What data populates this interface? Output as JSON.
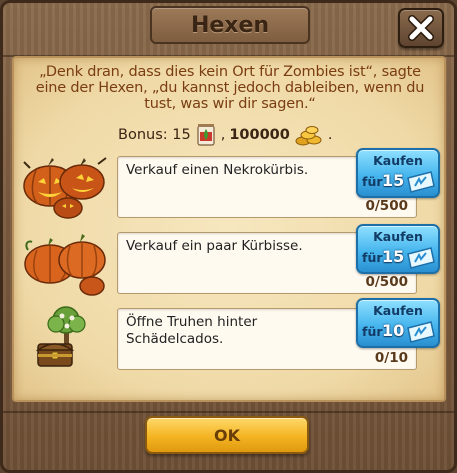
{
  "dialog": {
    "title": "Hexen",
    "quote_line1": "„Denk dran, dass dies kein Ort für Zombies ist“, sagte",
    "quote_line2": "eine der Hexen, „du kannst jedoch dableiben, wenn du",
    "quote_line3": "tust, was wir dir sagen.“",
    "bonus_label": "Bonus: 15",
    "bonus_separator": ",",
    "bonus_coins": "100000",
    "bonus_end": ".",
    "ok_label": "OK"
  },
  "tasks": [
    {
      "description": "Verkauf einen Nekrokürbis.",
      "progress": "0/500",
      "buy_label": "Kaufen",
      "buy_for": "für",
      "buy_price": "15",
      "icon": "jack-o-lantern-pumpkins-icon"
    },
    {
      "description": "Verkauf ein paar Kürbisse.",
      "progress": "0/500",
      "buy_label": "Kaufen",
      "buy_for": "für",
      "buy_price": "15",
      "icon": "pumpkins-icon"
    },
    {
      "description_line1": "Öffne Truhen hinter",
      "description_line2": "Schädelcados.",
      "progress": "0/10",
      "buy_label": "Kaufen",
      "buy_for": "für",
      "buy_price": "10",
      "icon": "treasure-chest-tree-icon"
    }
  ],
  "icons": {
    "close": "close-icon",
    "bonus_item": "seed-bag-icon",
    "coins": "gold-coins-icon",
    "ticket": "blue-ticket-icon"
  },
  "colors": {
    "buy_button": "#47b6ee",
    "ok_button": "#f4b422",
    "quote_text": "#7a3d12",
    "parchment": "#f2deb0"
  }
}
